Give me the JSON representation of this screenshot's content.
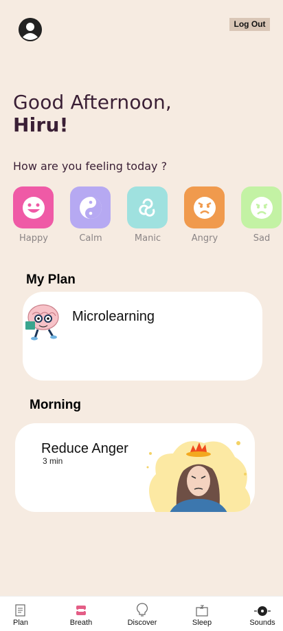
{
  "header": {
    "logout_label": "Log Out"
  },
  "greeting": {
    "line1": "Good Afternoon,",
    "name": "Hiru!"
  },
  "feeling_prompt": "How are you feeling today ?",
  "moods": [
    {
      "label": "Happy",
      "color": "#ef5aa6",
      "icon": "happy-face-icon"
    },
    {
      "label": "Calm",
      "color": "#b6a9f2",
      "icon": "yin-yang-icon"
    },
    {
      "label": "Manic",
      "color": "#9fe1df",
      "icon": "triskelion-icon"
    },
    {
      "label": "Angry",
      "color": "#f09a4d",
      "icon": "angry-face-icon"
    },
    {
      "label": "Sad",
      "color": "#c3f2a4",
      "icon": "sad-face-icon"
    }
  ],
  "my_plan": {
    "title": "My Plan",
    "card_title": "Microlearning"
  },
  "morning": {
    "title": "Morning",
    "card_title": "Reduce Anger",
    "duration": "3 min"
  },
  "nav": [
    {
      "label": "Plan",
      "icon": "plan-icon"
    },
    {
      "label": "Breath",
      "icon": "breath-icon"
    },
    {
      "label": "Discover",
      "icon": "discover-icon"
    },
    {
      "label": "Sleep",
      "icon": "sleep-icon"
    },
    {
      "label": "Sounds",
      "icon": "sounds-icon"
    }
  ]
}
